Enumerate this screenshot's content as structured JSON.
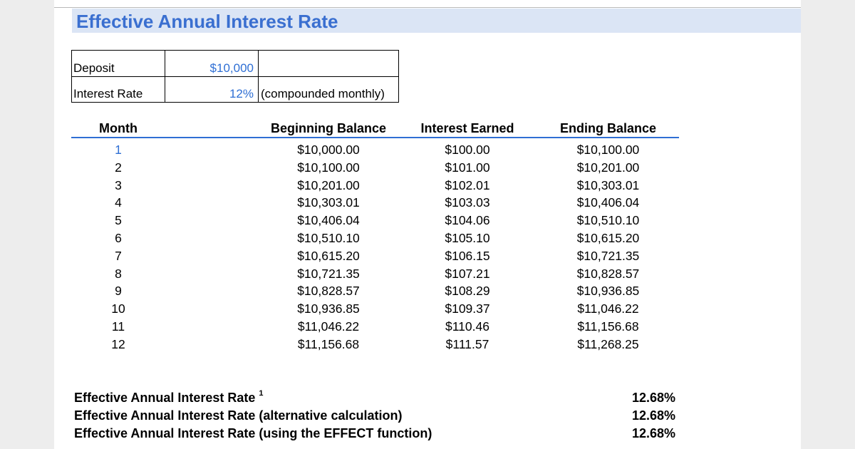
{
  "title": "Effective Annual Interest Rate",
  "inputs": {
    "deposit_label": "Deposit",
    "deposit_value": "$10,000",
    "rate_label": "Interest Rate",
    "rate_value": "12%",
    "rate_note": "(compounded monthly)"
  },
  "table": {
    "headers": [
      "Month",
      "Beginning Balance",
      "Interest Earned",
      "Ending Balance"
    ],
    "rows": [
      [
        "1",
        "$10,000.00",
        "$100.00",
        "$10,100.00"
      ],
      [
        "2",
        "$10,100.00",
        "$101.00",
        "$10,201.00"
      ],
      [
        "3",
        "$10,201.00",
        "$102.01",
        "$10,303.01"
      ],
      [
        "4",
        "$10,303.01",
        "$103.03",
        "$10,406.04"
      ],
      [
        "5",
        "$10,406.04",
        "$104.06",
        "$10,510.10"
      ],
      [
        "6",
        "$10,510.10",
        "$105.10",
        "$10,615.20"
      ],
      [
        "7",
        "$10,615.20",
        "$106.15",
        "$10,721.35"
      ],
      [
        "8",
        "$10,721.35",
        "$107.21",
        "$10,828.57"
      ],
      [
        "9",
        "$10,828.57",
        "$108.29",
        "$10,936.85"
      ],
      [
        "10",
        "$10,936.85",
        "$109.37",
        "$11,046.22"
      ],
      [
        "11",
        "$11,046.22",
        "$110.46",
        "$11,156.68"
      ],
      [
        "12",
        "$11,156.68",
        "$111.57",
        "$11,268.25"
      ]
    ]
  },
  "summary": [
    {
      "label": "Effective Annual Interest Rate",
      "footnote": "1",
      "value": "12.68%"
    },
    {
      "label": "Effective Annual Interest Rate (alternative calculation)",
      "footnote": "",
      "value": "12.68%"
    },
    {
      "label": "Effective Annual Interest Rate (using the EFFECT function)",
      "footnote": "",
      "value": "12.68%"
    }
  ],
  "colors": {
    "title": "#3a6fd0",
    "title_band": "#dbe5f5",
    "input_value": "#2f6fd4",
    "header_rule": "#2f6fd4"
  }
}
